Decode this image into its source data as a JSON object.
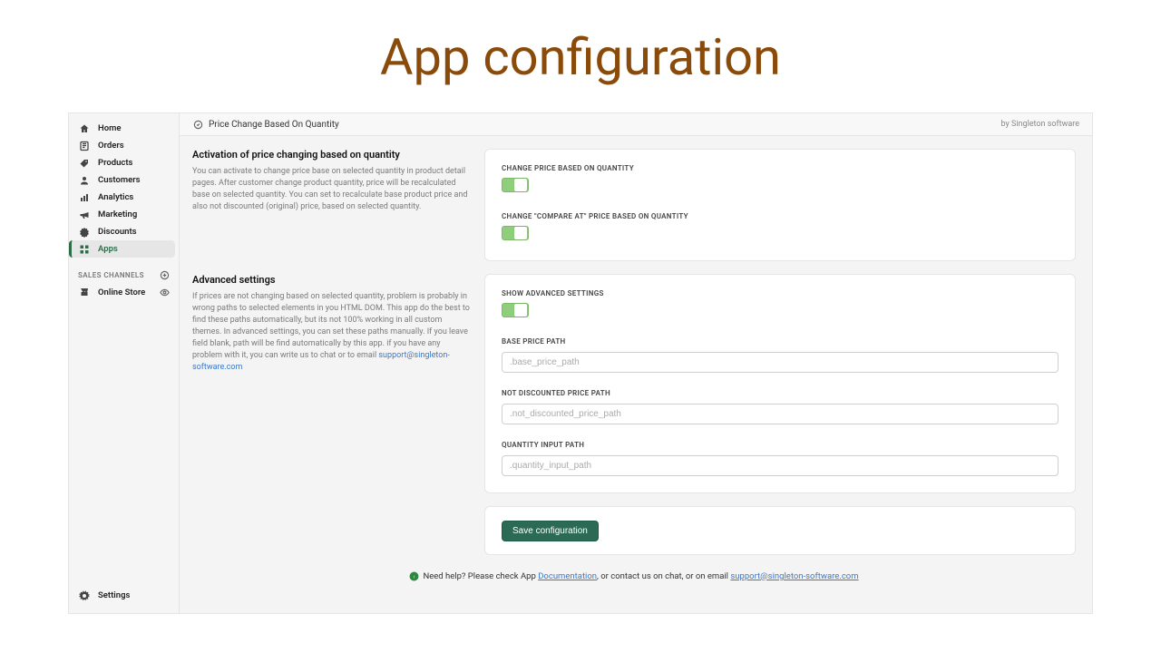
{
  "page": {
    "title": "App configuration"
  },
  "sidebar": {
    "items": [
      {
        "label": "Home"
      },
      {
        "label": "Orders"
      },
      {
        "label": "Products"
      },
      {
        "label": "Customers"
      },
      {
        "label": "Analytics"
      },
      {
        "label": "Marketing"
      },
      {
        "label": "Discounts"
      },
      {
        "label": "Apps"
      }
    ],
    "section_label": "SALES CHANNELS",
    "sales": {
      "label": "Online Store"
    },
    "settings_label": "Settings"
  },
  "topbar": {
    "app_name": "Price Change Based On Quantity",
    "by_label": "by Singleton software"
  },
  "section_activation": {
    "title": "Activation of price changing based on quantity",
    "desc": "You can activate to change price base on selected quantity in product detail pages. After customer change product quantity, price will be recalculated base on selected quantity. You can set to recalculate base product price and also not discounted (original) price, based on selected quantity.",
    "toggle1_label": "CHANGE PRICE BASED ON QUANTITY",
    "toggle2_label": "CHANGE \"COMPARE AT\" PRICE BASED ON QUANTITY"
  },
  "section_advanced": {
    "title": "Advanced settings",
    "desc_pre": "If prices are not changing based on selected quantity, problem is probably in wrong paths to selected elements in you HTML DOM. This app do the best to find these paths automatically, but its not 100% working in all custom themes. In advanced settings, you can set these paths manually. If you leave field blank, path will be find automatically by this app. if you have any problem with it, you can write us to chat or to email ",
    "support_email": "support@singleton-software.com",
    "toggle_show_label": "SHOW ADVANCED SETTINGS",
    "field1_label": "BASE PRICE PATH",
    "field1_placeholder": ".base_price_path",
    "field2_label": "NOT DISCOUNTED PRICE PATH",
    "field2_placeholder": ".not_discounted_price_path",
    "field3_label": "QUANTITY INPUT PATH",
    "field3_placeholder": ".quantity_input_path"
  },
  "actions": {
    "save_label": "Save configuration"
  },
  "footer": {
    "pre": "Need help? Please check App ",
    "doc_label": "Documentation",
    "mid": ", or contact us on chat, or on email ",
    "email": "support@singleton-software.com"
  }
}
